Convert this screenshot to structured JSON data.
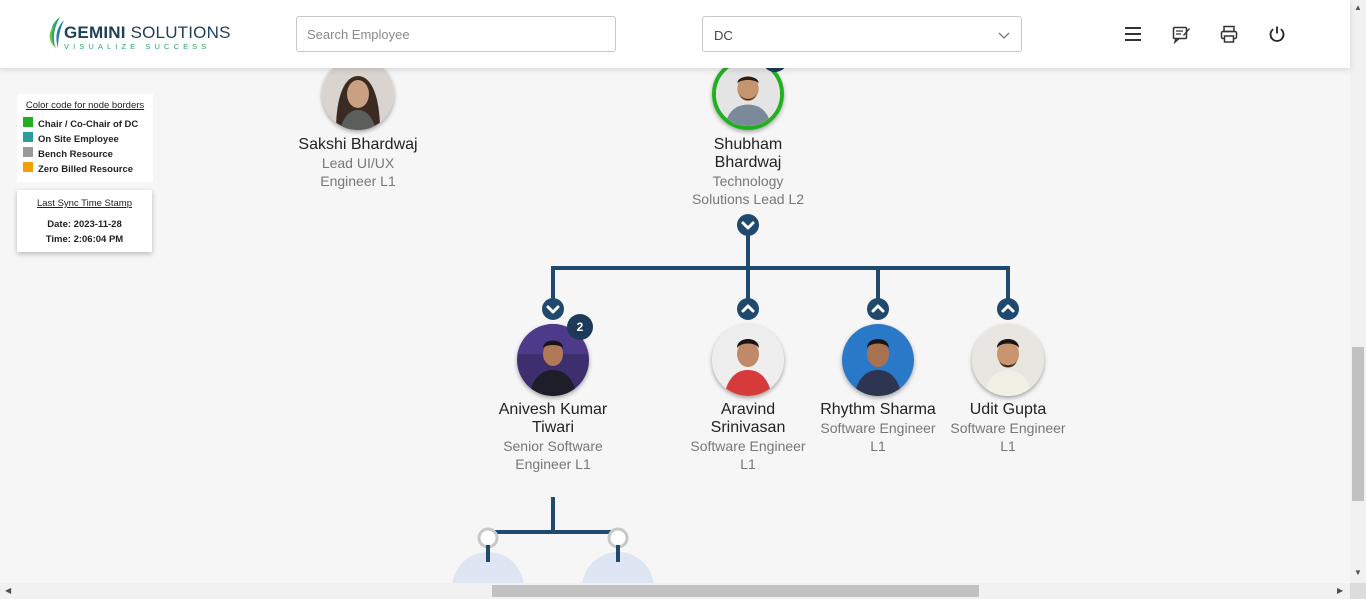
{
  "header": {
    "logo_main_bold": "GEMINI",
    "logo_main_rest": " SOLUTIONS",
    "logo_tagline": "VISUALIZE SUCCESS",
    "search_placeholder": "Search Employee",
    "select_value": "DC",
    "icons": [
      "menu-icon",
      "feedback-icon",
      "print-icon",
      "power-icon"
    ]
  },
  "legend": {
    "title": "Color code for node borders",
    "items": [
      {
        "label": "Chair / Co-Chair of DC",
        "color": "#22b022"
      },
      {
        "label": "On Site Employee",
        "color": "#2a9d9a"
      },
      {
        "label": "Bench Resource",
        "color": "#9a9a9a"
      },
      {
        "label": "Zero Billed Resource",
        "color": "#f0a000"
      }
    ]
  },
  "sync": {
    "title": "Last Sync Time Stamp",
    "date": "Date: 2023-11-28",
    "time": "Time: 2:06:04 PM"
  },
  "nodes": {
    "sakshi": {
      "name": "Sakshi Bhardwaj",
      "role": "Lead UI/UX Engineer L1"
    },
    "shubham": {
      "name": "Shubham Bhardwaj",
      "role": "Technology Solutions Lead L2"
    },
    "anivesh": {
      "name": "Anivesh Kumar Tiwari",
      "role": "Senior Software Engineer L1",
      "badge": "2"
    },
    "aravind": {
      "name": "Aravind Srinivasan",
      "role": "Software Engineer L1"
    },
    "rhythm": {
      "name": "Rhythm Sharma",
      "role": "Software Engineer L1"
    },
    "udit": {
      "name": "Udit Gupta",
      "role": "Software Engineer L1"
    }
  },
  "colors": {
    "connector": "#1f4a6e",
    "chair_border": "#22b022",
    "badge": "#1f3a58"
  }
}
